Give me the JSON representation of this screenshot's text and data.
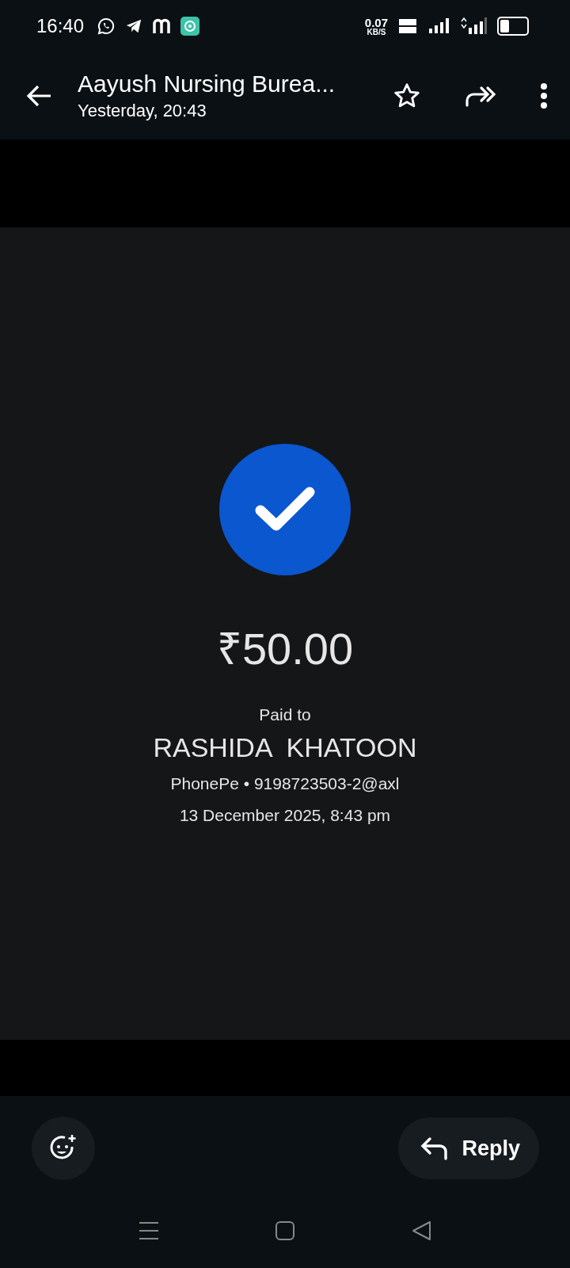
{
  "status_bar": {
    "time": "16:40",
    "speed": "0.07",
    "speed_unit": "KB/S"
  },
  "header": {
    "title": "Aayush Nursing Burea...",
    "subtitle": "Yesterday, 20:43",
    "starred": false
  },
  "receipt": {
    "success": true,
    "amount": "₹50.00",
    "paid_to_label": "Paid to",
    "payee": "RASHIDA  KHATOON",
    "method": "PhonePe • 9198723503-2@axl",
    "date": "13 December 2025, 8:43 pm"
  },
  "actions": {
    "reply": "Reply"
  }
}
